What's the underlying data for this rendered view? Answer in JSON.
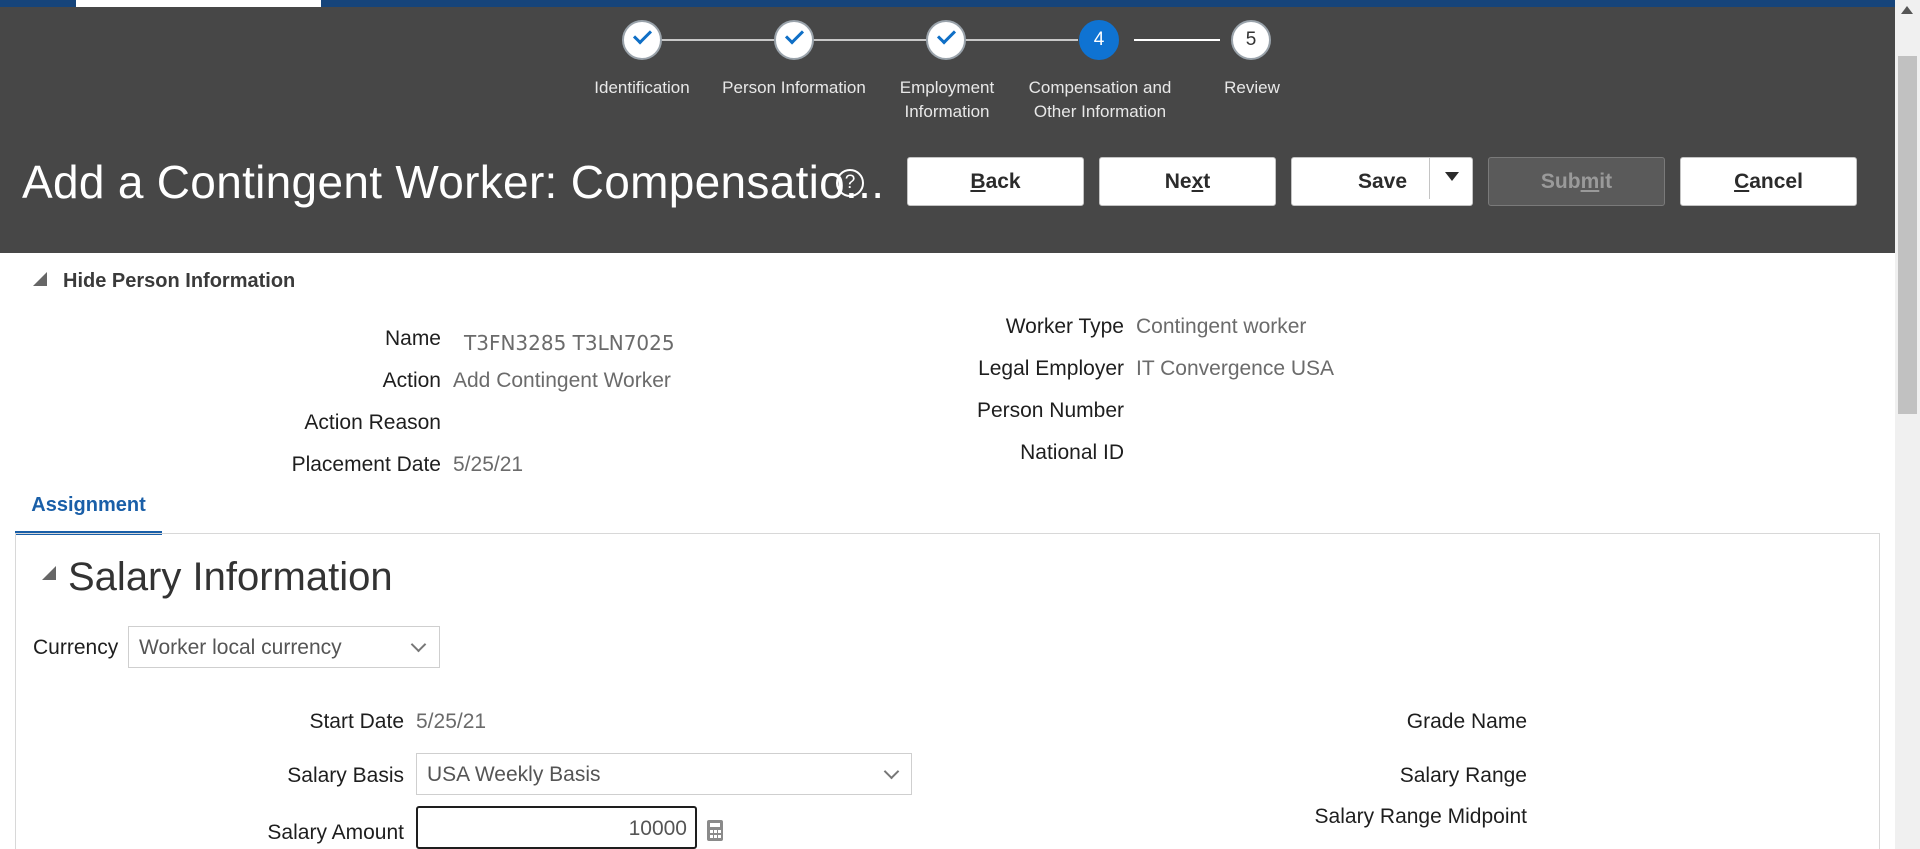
{
  "train": {
    "steps": [
      {
        "label": "Identification",
        "state": "done"
      },
      {
        "label": "Person Information",
        "state": "done"
      },
      {
        "label": "Employment\nInformation",
        "state": "done"
      },
      {
        "label": "Compensation and\nOther Information",
        "state": "current",
        "number": "4"
      },
      {
        "label": "Review",
        "state": "todo",
        "number": "5"
      }
    ]
  },
  "header": {
    "title": "Add a Contingent Worker: Compensatio...",
    "help_icon": "?"
  },
  "toolbar": {
    "back_prefix": "",
    "back_key": "B",
    "back_suffix": "ack",
    "next_prefix": "Ne",
    "next_key": "x",
    "next_suffix": "t",
    "save_label": "Save",
    "submit_prefix": "Sub",
    "submit_key": "m",
    "submit_suffix": "it",
    "cancel_prefix": "",
    "cancel_key": "C",
    "cancel_suffix": "ancel"
  },
  "person_info": {
    "toggle_label": "Hide Person Information",
    "left": [
      {
        "label": "Name",
        "value": "T3FN3285 T3LN7025"
      },
      {
        "label": "Action",
        "value": "Add Contingent Worker"
      },
      {
        "label": "Action Reason",
        "value": ""
      },
      {
        "label": "Placement Date",
        "value": "5/25/21"
      }
    ],
    "right": [
      {
        "label": "Worker Type",
        "value": "Contingent worker"
      },
      {
        "label": "Legal Employer",
        "value": "IT Convergence USA"
      },
      {
        "label": "Person Number",
        "value": ""
      },
      {
        "label": "National ID",
        "value": ""
      }
    ]
  },
  "tabs": {
    "active": "Assignment"
  },
  "salary": {
    "section_title": "Salary Information",
    "currency_label": "Currency",
    "currency_value": "Worker local currency",
    "start_date_label": "Start Date",
    "start_date_value": "5/25/21",
    "salary_basis_label": "Salary Basis",
    "salary_basis_value": "USA Weekly Basis",
    "salary_amount_label": "Salary Amount",
    "salary_amount_value": "10000",
    "grade_name_label": "Grade Name",
    "salary_range_label": "Salary Range",
    "salary_range_midpoint_label": "Salary Range Midpoint"
  },
  "colors": {
    "header_bg": "#474747",
    "accent": "#0f73d2",
    "tab_active": "#1a5fa8"
  }
}
